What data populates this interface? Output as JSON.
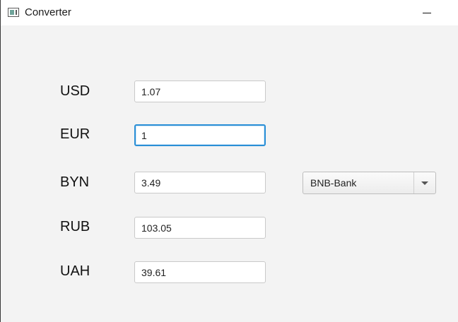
{
  "window": {
    "title": "Converter",
    "minimize_icon": "minimize-icon"
  },
  "currencies": [
    {
      "code": "USD",
      "value": "1.07"
    },
    {
      "code": "EUR",
      "value": "1"
    },
    {
      "code": "BYN",
      "value": "3.49"
    },
    {
      "code": "RUB",
      "value": "103.05"
    },
    {
      "code": "UAH",
      "value": "39.61"
    }
  ],
  "bank_select": {
    "selected": "BNB-Bank",
    "arrow_icon": "chevron-down-icon"
  },
  "colors": {
    "focus_border": "#2a8fd6",
    "background": "#f3f3f3"
  }
}
